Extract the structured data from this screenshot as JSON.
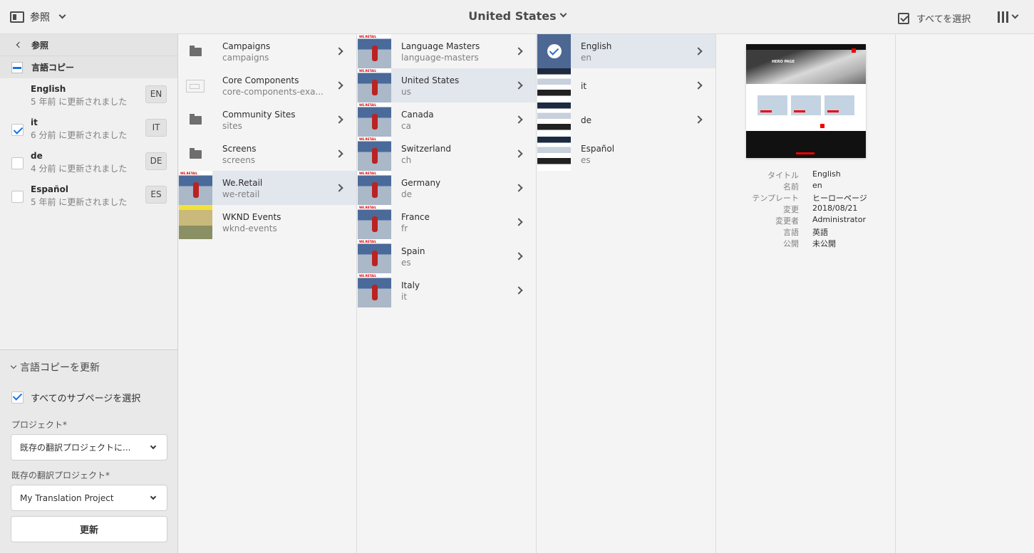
{
  "topbar": {
    "rail_label": "参照",
    "title": "United States",
    "select_all": "すべてを選択"
  },
  "left": {
    "back_label": "参照",
    "section_label": "言語コピー",
    "languages": [
      {
        "name": "English",
        "updated": "5 年前 に更新されました",
        "code": "EN",
        "checked": false
      },
      {
        "name": "it",
        "updated": "6 分前 に更新されました",
        "code": "IT",
        "checked": true
      },
      {
        "name": "de",
        "updated": "4 分前 に更新されました",
        "code": "DE",
        "checked": false
      },
      {
        "name": "Español",
        "updated": "5 年前 に更新されました",
        "code": "ES",
        "checked": false
      }
    ],
    "update": {
      "heading": "言語コピーを更新",
      "subpages_label": "すべてのサブページを選択",
      "project_label": "プロジェクト*",
      "project_value": "既存の翻訳プロジェクトに...",
      "existing_label": "既存の翻訳プロジェクト*",
      "existing_value": "My Translation Project",
      "button": "更新"
    }
  },
  "columns": {
    "col1": [
      {
        "title": "Campaigns",
        "sub": "campaigns",
        "thumb": "folder"
      },
      {
        "title": "Core Components",
        "sub": "core-components-exa...",
        "thumb": "component"
      },
      {
        "title": "Community Sites",
        "sub": "sites",
        "thumb": "folder"
      },
      {
        "title": "Screens",
        "sub": "screens",
        "thumb": "folder"
      },
      {
        "title": "We.Retail",
        "sub": "we-retail",
        "thumb": "we-retail",
        "selected": true
      },
      {
        "title": "WKND Events",
        "sub": "wknd-events",
        "thumb": "wknd"
      }
    ],
    "col2": [
      {
        "title": "Language Masters",
        "sub": "language-masters"
      },
      {
        "title": "United States",
        "sub": "us",
        "selected": true
      },
      {
        "title": "Canada",
        "sub": "ca"
      },
      {
        "title": "Switzerland",
        "sub": "ch"
      },
      {
        "title": "Germany",
        "sub": "de"
      },
      {
        "title": "France",
        "sub": "fr"
      },
      {
        "title": "Spain",
        "sub": "es"
      },
      {
        "title": "Italy",
        "sub": "it"
      }
    ],
    "col3": [
      {
        "title": "English",
        "sub": "en",
        "selected": true
      },
      {
        "title": "it",
        "sub": ""
      },
      {
        "title": "de",
        "sub": ""
      },
      {
        "title": "Español",
        "sub": "es"
      }
    ]
  },
  "preview": {
    "meta": [
      {
        "key": "タイトル",
        "value": "English"
      },
      {
        "key": "名前",
        "value": "en"
      },
      {
        "key": "テンプレート",
        "value": "ヒーローページ"
      },
      {
        "key": "変更",
        "value": "2018/08/21"
      },
      {
        "key": "変更者",
        "value": "Administrator"
      },
      {
        "key": "言語",
        "value": "英語"
      },
      {
        "key": "公開",
        "value": "未公開"
      }
    ]
  }
}
